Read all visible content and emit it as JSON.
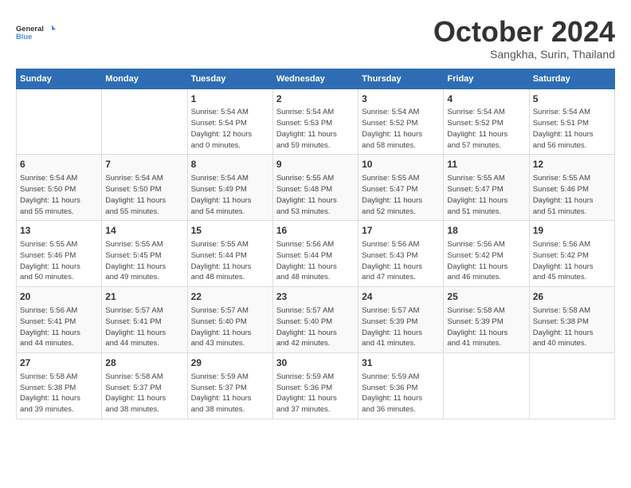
{
  "logo": {
    "line1": "General",
    "line2": "Blue"
  },
  "title": "October 2024",
  "subtitle": "Sangkha, Surin, Thailand",
  "weekdays": [
    "Sunday",
    "Monday",
    "Tuesday",
    "Wednesday",
    "Thursday",
    "Friday",
    "Saturday"
  ],
  "weeks": [
    [
      {
        "day": "",
        "info": ""
      },
      {
        "day": "",
        "info": ""
      },
      {
        "day": "1",
        "info": "Sunrise: 5:54 AM\nSunset: 5:54 PM\nDaylight: 12 hours\nand 0 minutes."
      },
      {
        "day": "2",
        "info": "Sunrise: 5:54 AM\nSunset: 5:53 PM\nDaylight: 11 hours\nand 59 minutes."
      },
      {
        "day": "3",
        "info": "Sunrise: 5:54 AM\nSunset: 5:52 PM\nDaylight: 11 hours\nand 58 minutes."
      },
      {
        "day": "4",
        "info": "Sunrise: 5:54 AM\nSunset: 5:52 PM\nDaylight: 11 hours\nand 57 minutes."
      },
      {
        "day": "5",
        "info": "Sunrise: 5:54 AM\nSunset: 5:51 PM\nDaylight: 11 hours\nand 56 minutes."
      }
    ],
    [
      {
        "day": "6",
        "info": "Sunrise: 5:54 AM\nSunset: 5:50 PM\nDaylight: 11 hours\nand 55 minutes."
      },
      {
        "day": "7",
        "info": "Sunrise: 5:54 AM\nSunset: 5:50 PM\nDaylight: 11 hours\nand 55 minutes."
      },
      {
        "day": "8",
        "info": "Sunrise: 5:54 AM\nSunset: 5:49 PM\nDaylight: 11 hours\nand 54 minutes."
      },
      {
        "day": "9",
        "info": "Sunrise: 5:55 AM\nSunset: 5:48 PM\nDaylight: 11 hours\nand 53 minutes."
      },
      {
        "day": "10",
        "info": "Sunrise: 5:55 AM\nSunset: 5:47 PM\nDaylight: 11 hours\nand 52 minutes."
      },
      {
        "day": "11",
        "info": "Sunrise: 5:55 AM\nSunset: 5:47 PM\nDaylight: 11 hours\nand 51 minutes."
      },
      {
        "day": "12",
        "info": "Sunrise: 5:55 AM\nSunset: 5:46 PM\nDaylight: 11 hours\nand 51 minutes."
      }
    ],
    [
      {
        "day": "13",
        "info": "Sunrise: 5:55 AM\nSunset: 5:46 PM\nDaylight: 11 hours\nand 50 minutes."
      },
      {
        "day": "14",
        "info": "Sunrise: 5:55 AM\nSunset: 5:45 PM\nDaylight: 11 hours\nand 49 minutes."
      },
      {
        "day": "15",
        "info": "Sunrise: 5:55 AM\nSunset: 5:44 PM\nDaylight: 11 hours\nand 48 minutes."
      },
      {
        "day": "16",
        "info": "Sunrise: 5:56 AM\nSunset: 5:44 PM\nDaylight: 11 hours\nand 48 minutes."
      },
      {
        "day": "17",
        "info": "Sunrise: 5:56 AM\nSunset: 5:43 PM\nDaylight: 11 hours\nand 47 minutes."
      },
      {
        "day": "18",
        "info": "Sunrise: 5:56 AM\nSunset: 5:42 PM\nDaylight: 11 hours\nand 46 minutes."
      },
      {
        "day": "19",
        "info": "Sunrise: 5:56 AM\nSunset: 5:42 PM\nDaylight: 11 hours\nand 45 minutes."
      }
    ],
    [
      {
        "day": "20",
        "info": "Sunrise: 5:56 AM\nSunset: 5:41 PM\nDaylight: 11 hours\nand 44 minutes."
      },
      {
        "day": "21",
        "info": "Sunrise: 5:57 AM\nSunset: 5:41 PM\nDaylight: 11 hours\nand 44 minutes."
      },
      {
        "day": "22",
        "info": "Sunrise: 5:57 AM\nSunset: 5:40 PM\nDaylight: 11 hours\nand 43 minutes."
      },
      {
        "day": "23",
        "info": "Sunrise: 5:57 AM\nSunset: 5:40 PM\nDaylight: 11 hours\nand 42 minutes."
      },
      {
        "day": "24",
        "info": "Sunrise: 5:57 AM\nSunset: 5:39 PM\nDaylight: 11 hours\nand 41 minutes."
      },
      {
        "day": "25",
        "info": "Sunrise: 5:58 AM\nSunset: 5:39 PM\nDaylight: 11 hours\nand 41 minutes."
      },
      {
        "day": "26",
        "info": "Sunrise: 5:58 AM\nSunset: 5:38 PM\nDaylight: 11 hours\nand 40 minutes."
      }
    ],
    [
      {
        "day": "27",
        "info": "Sunrise: 5:58 AM\nSunset: 5:38 PM\nDaylight: 11 hours\nand 39 minutes."
      },
      {
        "day": "28",
        "info": "Sunrise: 5:58 AM\nSunset: 5:37 PM\nDaylight: 11 hours\nand 38 minutes."
      },
      {
        "day": "29",
        "info": "Sunrise: 5:59 AM\nSunset: 5:37 PM\nDaylight: 11 hours\nand 38 minutes."
      },
      {
        "day": "30",
        "info": "Sunrise: 5:59 AM\nSunset: 5:36 PM\nDaylight: 11 hours\nand 37 minutes."
      },
      {
        "day": "31",
        "info": "Sunrise: 5:59 AM\nSunset: 5:36 PM\nDaylight: 11 hours\nand 36 minutes."
      },
      {
        "day": "",
        "info": ""
      },
      {
        "day": "",
        "info": ""
      }
    ]
  ]
}
